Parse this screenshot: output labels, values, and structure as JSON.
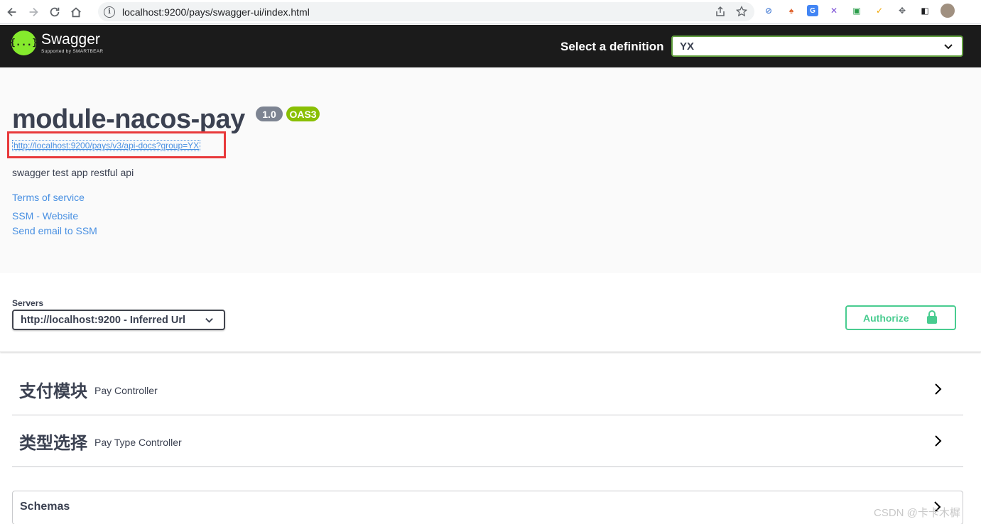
{
  "browser": {
    "url": "localhost:9200/pays/swagger-ui/index.html"
  },
  "topbar": {
    "logo_symbol": "{...}",
    "logo_title": "Swagger",
    "logo_sub": "Supported by SMARTBEAR",
    "definition_label": "Select a definition",
    "definition_value": "YX"
  },
  "info": {
    "title": "module-nacos-pay",
    "version": "1.0",
    "oas": "OAS3",
    "spec_url": "http://localhost:9200/pays/v3/api-docs?group=YX",
    "description": "swagger test app restful api",
    "terms": "Terms of service",
    "website": "SSM - Website",
    "email": "Send email to SSM"
  },
  "servers": {
    "label": "Servers",
    "selected": "http://localhost:9200 - Inferred Url"
  },
  "authorize": {
    "label": "Authorize"
  },
  "tags": [
    {
      "name": "支付模块",
      "description": "Pay Controller"
    },
    {
      "name": "类型选择",
      "description": "Pay Type Controller"
    }
  ],
  "schemas": {
    "title": "Schemas"
  },
  "watermark": "CSDN @卡卡木樨",
  "colors": {
    "topbar_bg": "#1b1b1b",
    "swagger_green": "#85ea2d",
    "authorize_green": "#49cc90",
    "link_blue": "#4990e2",
    "highlight_red": "#e8393b",
    "oas_green": "#89bf04",
    "version_gray": "#7d8492"
  }
}
